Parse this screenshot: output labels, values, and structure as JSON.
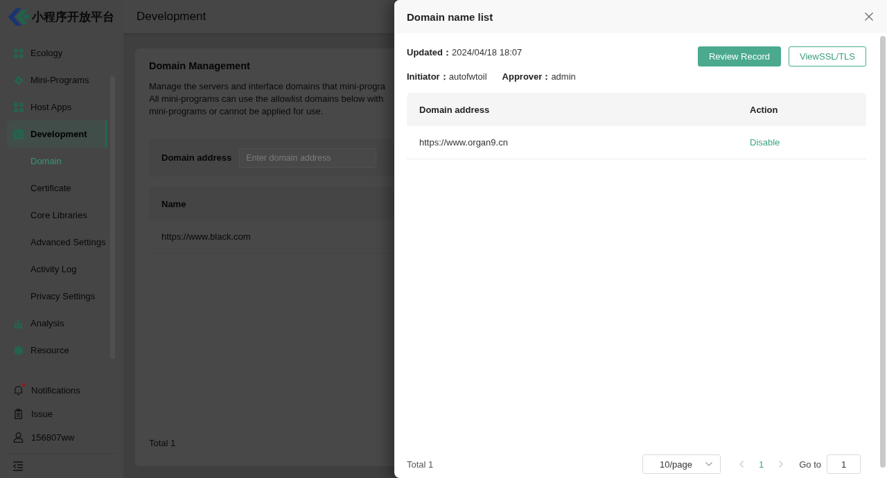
{
  "sidebar": {
    "brand": "小程序开放平台",
    "menu": [
      {
        "label": "Ecology",
        "selected": false
      },
      {
        "label": "Mini-Programs",
        "selected": false
      },
      {
        "label": "Host Apps",
        "selected": false
      },
      {
        "label": "Development",
        "selected": true,
        "children": [
          {
            "label": "Domain",
            "selected": true
          },
          {
            "label": "Certificate",
            "selected": false
          },
          {
            "label": "Core Libraries",
            "selected": false
          },
          {
            "label": "Advanced Settings",
            "selected": false
          },
          {
            "label": "Activity Log",
            "selected": false
          },
          {
            "label": "Privacy Settings",
            "selected": false
          }
        ]
      },
      {
        "label": "Analysis",
        "selected": false
      },
      {
        "label": "Resource",
        "selected": false
      }
    ],
    "footer_items": [
      {
        "label": "Notifications",
        "badge": true
      },
      {
        "label": "Issue",
        "badge": false
      },
      {
        "label": "156807ww",
        "badge": false
      }
    ]
  },
  "header": {
    "title": "Development"
  },
  "page": {
    "title": "Domain Management",
    "description_lines": [
      "Manage the servers and interface domains that mini-progra",
      "All mini-programs can use the allowlist domains below with",
      "mini-programs or cannot be applied for use."
    ],
    "filter": {
      "label": "Domain address",
      "placeholder": "Enter domain address"
    },
    "table": {
      "columns": [
        "Name"
      ],
      "rows": [
        [
          "https://www.black.com"
        ]
      ]
    },
    "total": "Total 1"
  },
  "drawer": {
    "title": "Domain name list",
    "meta_rows": [
      [
        {
          "label": "Updated：",
          "value": "2024/04/18 18:07"
        }
      ],
      [
        {
          "label": "Initiator：",
          "value": "autofwtoil"
        },
        {
          "label": "Approver：",
          "value": "admin"
        }
      ]
    ],
    "buttons": [
      {
        "label": "Review Record",
        "kind": "primary"
      },
      {
        "label": "ViewSSL/TLS",
        "kind": "outline"
      }
    ],
    "table": {
      "columns": [
        "Domain address",
        "Action"
      ],
      "rows": [
        {
          "domain": "https://www.organ9.cn",
          "action": "Disable"
        }
      ]
    },
    "pagination": {
      "total": "Total 1",
      "page_size": "10/page",
      "prev_disabled": true,
      "pages": [
        {
          "label": "1",
          "selected": true
        }
      ],
      "next_disabled": true,
      "goto_label": "Go to",
      "goto_value": "1"
    }
  }
}
